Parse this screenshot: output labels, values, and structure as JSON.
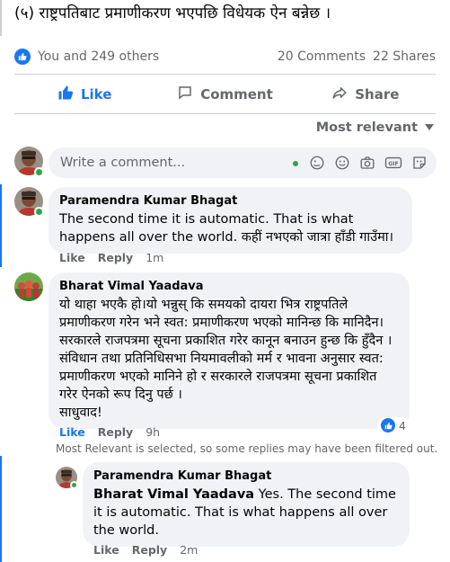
{
  "post": {
    "headline": "(५) राष्ट्रपतिबाट प्रमाणीकरण भएपछि विधेयक ऐन बन्नेछ ।"
  },
  "stats": {
    "reactions_text": "You and 249 others",
    "comments_text": "20 Comments",
    "shares_text": "22 Shares"
  },
  "actions": {
    "like": "Like",
    "comment": "Comment",
    "share": "Share"
  },
  "sort": {
    "label": "Most relevant"
  },
  "composer": {
    "placeholder": "Write a comment..."
  },
  "comments": [
    {
      "author": "Paramendra Kumar Bhagat",
      "text": "The second time it is automatic. That is what happens all over the world. कहीं नभएको जात्रा हाँडी गाउँमा।",
      "like": "Like",
      "reply": "Reply",
      "time": "1m"
    },
    {
      "author": "Bharat Vimal Yaadava",
      "text_lines": [
        "यो थाहा भएकै हो।यो भन्नुस् कि समयको दायरा भित्र राष्ट्रपतिले",
        "प्रमाणीकरण गरेन भने स्वत: प्रमाणीकरण भएको मानिन्छ कि मानिदैन।",
        "सरकारले राजपत्रमा सूचना प्रकाशित गरेर कानून बनाउन हुन्छ कि हुँदैन ।",
        "संविधान तथा प्रतिनिधिसभा नियमावलीको मर्म र भावना अनुसार स्वत:",
        "प्रमाणीकरण भएको मानिने हो र सरकारले राजपत्रमा सूचना प्रकाशित",
        "गरेर ऐनको रूप दिनु पर्छ ।",
        "साधुवाद!"
      ],
      "like": "Like",
      "reply": "Reply",
      "time": "9h",
      "reaction_count": "4"
    }
  ],
  "filter_note": "Most Relevant is selected, so some replies may have been filtered out.",
  "reply": {
    "author": "Paramendra Kumar Bhagat",
    "tag": "Bharat Vimal Yaadava",
    "text": " Yes. The second time it is automatic. That is what happens all over the world.",
    "like": "Like",
    "reply": "Reply",
    "time": "2m"
  },
  "colors": {
    "accent": "#1877f2",
    "online": "#31a24c",
    "bubble": "#f0f2f5",
    "muted": "#65676b"
  }
}
